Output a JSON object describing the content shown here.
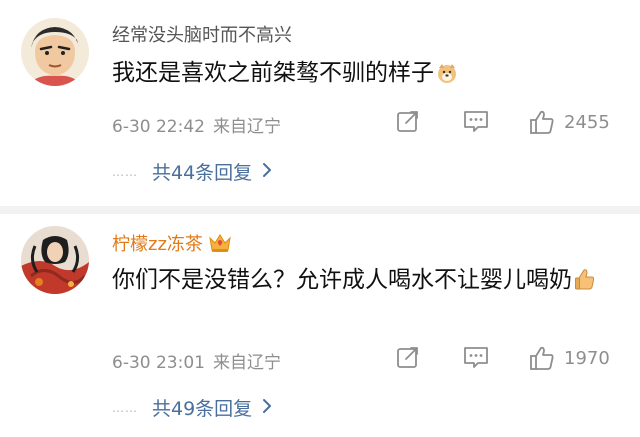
{
  "comments": [
    {
      "username": "经常没头脑时而不高兴",
      "text": "我还是喜欢之前桀骜不驯的样子",
      "emoji": "doge-emoji",
      "date": "6-30 22:42",
      "location": "来自辽宁",
      "likes": "2455",
      "replies": "共44条回复",
      "dots": "……"
    },
    {
      "username": "柠檬zz冻茶",
      "text": "你们不是没错么？允许成人喝水不让婴儿喝奶",
      "emoji": "thumbs-up-emoji",
      "date": "6-30 23:01",
      "location": "来自辽宁",
      "likes": "1970",
      "replies": "共49条回复",
      "dots": "……"
    }
  ],
  "colors": {
    "username_default": "#555555",
    "username_vip": "#e07b17",
    "reply_link": "#4a6f9c",
    "meta": "#8e8e8e",
    "divider": "#f2f2f2"
  }
}
